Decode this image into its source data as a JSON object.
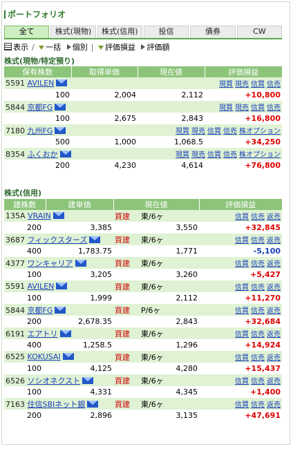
{
  "title": "ポートフォリオ",
  "tabs": [
    "全て",
    "株式(現物)",
    "株式(信用)",
    "投信",
    "債券",
    "CW"
  ],
  "toolbar": {
    "display": "表示",
    "ikkatsu": "一括",
    "kobetsu": "個別",
    "hyouka_soneki": "評価損益",
    "hyouka_gaku": "評価額"
  },
  "spot": {
    "section_title": "株式(現物/特定預り)",
    "headers": [
      "保有株数",
      "取得単価",
      "現在値",
      "評価損益"
    ],
    "rows": [
      {
        "code": "5591",
        "name": "AVILEN",
        "qty": "100",
        "cost": "2,004",
        "price": "2,112",
        "pl": "+10,800",
        "acts": [
          "現買",
          "現売",
          "信買",
          "信売"
        ]
      },
      {
        "code": "5844",
        "name": "京都FG",
        "qty": "100",
        "cost": "2,675",
        "price": "2,843",
        "pl": "+16,800",
        "acts": [
          "現買",
          "現売",
          "信買",
          "信売"
        ]
      },
      {
        "code": "7180",
        "name": "九州FG",
        "qty": "500",
        "cost": "1,000",
        "price": "1,068.5",
        "pl": "+34,250",
        "acts": [
          "現買",
          "現売",
          "信買",
          "信売",
          "株オプション"
        ]
      },
      {
        "code": "8354",
        "name": "ふくおか",
        "qty": "200",
        "cost": "4,230",
        "price": "4,614",
        "pl": "+76,800",
        "acts": [
          "現買",
          "現売",
          "信買",
          "信売",
          "株オプション"
        ]
      }
    ]
  },
  "margin": {
    "section_title": "株式(信用)",
    "headers": [
      "建株数",
      "建単価",
      "現在値",
      "評価損益"
    ],
    "rows": [
      {
        "code": "135A",
        "name": "VRAIN",
        "qty": "200",
        "cost": "3,385",
        "price": "3,550",
        "side": "買建",
        "term": "東/6ヶ",
        "pl": "+32,845",
        "pl_sign": "plus",
        "acts": [
          "信買",
          "信売",
          "返売"
        ]
      },
      {
        "code": "3687",
        "name": "フィックスターズ",
        "qty": "400",
        "cost": "1,783.75",
        "price": "1,771",
        "side": "買建",
        "term": "東/6ヶ",
        "pl": "-5,100",
        "pl_sign": "minus",
        "acts": [
          "信買",
          "信売",
          "返売"
        ]
      },
      {
        "code": "4377",
        "name": "ワンキャリア",
        "qty": "100",
        "cost": "3,205",
        "price": "3,260",
        "side": "買建",
        "term": "東/6ヶ",
        "pl": "+5,427",
        "pl_sign": "plus",
        "acts": [
          "信買",
          "信売",
          "返売"
        ]
      },
      {
        "code": "5591",
        "name": "AVILEN",
        "qty": "100",
        "cost": "1,999",
        "price": "2,112",
        "side": "買建",
        "term": "東/6ヶ",
        "pl": "+11,270",
        "pl_sign": "plus",
        "acts": [
          "信買",
          "信売",
          "返売"
        ]
      },
      {
        "code": "5844",
        "name": "京都FG",
        "qty": "200",
        "cost": "2,678.35",
        "price": "2,843",
        "side": "買建",
        "term": "P/6ヶ",
        "pl": "+32,684",
        "pl_sign": "plus",
        "acts": [
          "信買",
          "信売",
          "返売"
        ]
      },
      {
        "code": "6191",
        "name": "エアトリ",
        "qty": "400",
        "cost": "1,258.5",
        "price": "1,296",
        "side": "買建",
        "term": "東/6ヶ",
        "pl": "+14,924",
        "pl_sign": "plus",
        "acts": [
          "信買",
          "信売",
          "返売"
        ]
      },
      {
        "code": "6525",
        "name": "KOKUSAI",
        "qty": "100",
        "cost": "4,125",
        "price": "4,280",
        "side": "買建",
        "term": "東/6ヶ",
        "pl": "+15,437",
        "pl_sign": "plus",
        "acts": [
          "信買",
          "信売",
          "返売"
        ]
      },
      {
        "code": "6526",
        "name": "ソシオネクスト",
        "qty": "100",
        "cost": "4,331",
        "price": "4,345",
        "side": "買建",
        "term": "東/6ヶ",
        "pl": "+1,400",
        "pl_sign": "plus",
        "acts": [
          "信買",
          "信売",
          "返売"
        ]
      },
      {
        "code": "7163",
        "name": "住信SBIネット銀",
        "qty": "200",
        "cost": "2,896",
        "price": "3,135",
        "side": "買建",
        "term": "東/6ヶ",
        "pl": "+47,691",
        "pl_sign": "plus",
        "acts": [
          "信買",
          "信売",
          "返売"
        ]
      }
    ]
  }
}
